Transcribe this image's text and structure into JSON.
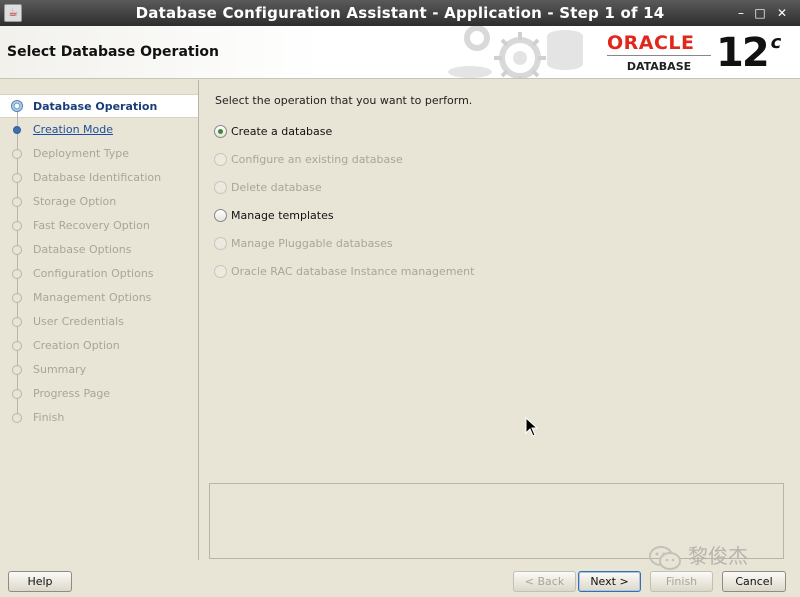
{
  "window": {
    "title": "Database Configuration Assistant - Application - Step 1 of 14",
    "controls": {
      "minimize": "–",
      "maximize": "□",
      "close": "✕"
    }
  },
  "header": {
    "heading": "Select Database Operation",
    "logo_word": "ORACLE",
    "logo_sub": "DATABASE",
    "version": "12",
    "version_suffix": "c",
    "brand_color": "#e1261c"
  },
  "sidebar": {
    "steps": [
      {
        "label": "Database Operation",
        "state": "active"
      },
      {
        "label": "Creation Mode",
        "state": "next"
      },
      {
        "label": "Deployment Type",
        "state": "disabled"
      },
      {
        "label": "Database Identification",
        "state": "disabled"
      },
      {
        "label": "Storage Option",
        "state": "disabled"
      },
      {
        "label": "Fast Recovery Option",
        "state": "disabled"
      },
      {
        "label": "Database Options",
        "state": "disabled"
      },
      {
        "label": "Configuration Options",
        "state": "disabled"
      },
      {
        "label": "Management Options",
        "state": "disabled"
      },
      {
        "label": "User Credentials",
        "state": "disabled"
      },
      {
        "label": "Creation Option",
        "state": "disabled"
      },
      {
        "label": "Summary",
        "state": "disabled"
      },
      {
        "label": "Progress Page",
        "state": "disabled"
      },
      {
        "label": "Finish",
        "state": "disabled"
      }
    ]
  },
  "main": {
    "prompt": "Select the operation that you want to perform.",
    "options": [
      {
        "label": "Create a database",
        "checked": true,
        "enabled": true
      },
      {
        "label": "Configure an existing database",
        "checked": false,
        "enabled": false
      },
      {
        "label": "Delete database",
        "checked": false,
        "enabled": false
      },
      {
        "label": "Manage templates",
        "checked": false,
        "enabled": true
      },
      {
        "label": "Manage Pluggable databases",
        "checked": false,
        "enabled": false
      },
      {
        "label": "Oracle RAC database Instance management",
        "checked": false,
        "enabled": false
      }
    ]
  },
  "footer": {
    "help": "Help",
    "back": "< Back",
    "next": "Next >",
    "finish": "Finish",
    "cancel": "Cancel"
  },
  "watermark": {
    "text": "黎俊杰"
  }
}
